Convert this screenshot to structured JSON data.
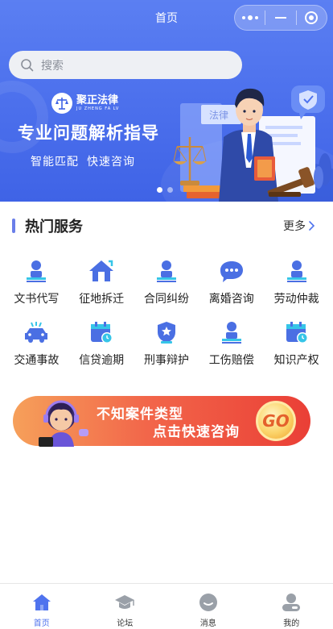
{
  "page_title": "首页",
  "search": {
    "placeholder": "搜索"
  },
  "banner": {
    "brand_cn": "聚正法律",
    "brand_en": "JU ZHENG FA LV",
    "headline": "专业问题解析指导",
    "tagline_1": "智能匹配",
    "tagline_2": "快速咨询",
    "illustration_sign": "法律",
    "slide_count": 2,
    "active_slide": 1
  },
  "section": {
    "title": "热门服务",
    "more_label": "更多"
  },
  "services": [
    {
      "label": "文书代写",
      "icon": "person-desk-icon"
    },
    {
      "label": "征地拆迁",
      "icon": "house-icon"
    },
    {
      "label": "合同纠纷",
      "icon": "person-desk-icon"
    },
    {
      "label": "离婚咨询",
      "icon": "chat-bubble-icon"
    },
    {
      "label": "劳动仲裁",
      "icon": "person-desk-icon"
    },
    {
      "label": "交通事故",
      "icon": "car-crash-icon"
    },
    {
      "label": "信贷逾期",
      "icon": "calendar-clock-icon"
    },
    {
      "label": "刑事辩护",
      "icon": "shield-star-icon"
    },
    {
      "label": "工伤赔偿",
      "icon": "person-desk-icon"
    },
    {
      "label": "知识产权",
      "icon": "calendar-clock-icon"
    }
  ],
  "promo": {
    "line1": "不知案件类型",
    "line2": "点击快速咨询",
    "go_label": "GO"
  },
  "tabs": [
    {
      "label": "首页",
      "icon": "home-icon",
      "active": true
    },
    {
      "label": "论坛",
      "icon": "graduation-cap-icon",
      "active": false
    },
    {
      "label": "消息",
      "icon": "message-icon",
      "active": false
    },
    {
      "label": "我的",
      "icon": "user-icon",
      "active": false
    }
  ],
  "colors": {
    "primary": "#4f73ee",
    "icon_blue": "#4a6fe3",
    "icon_cyan": "#36c5e8",
    "promo_red": "#ea3f36",
    "tab_inactive": "#9aa0a8"
  }
}
